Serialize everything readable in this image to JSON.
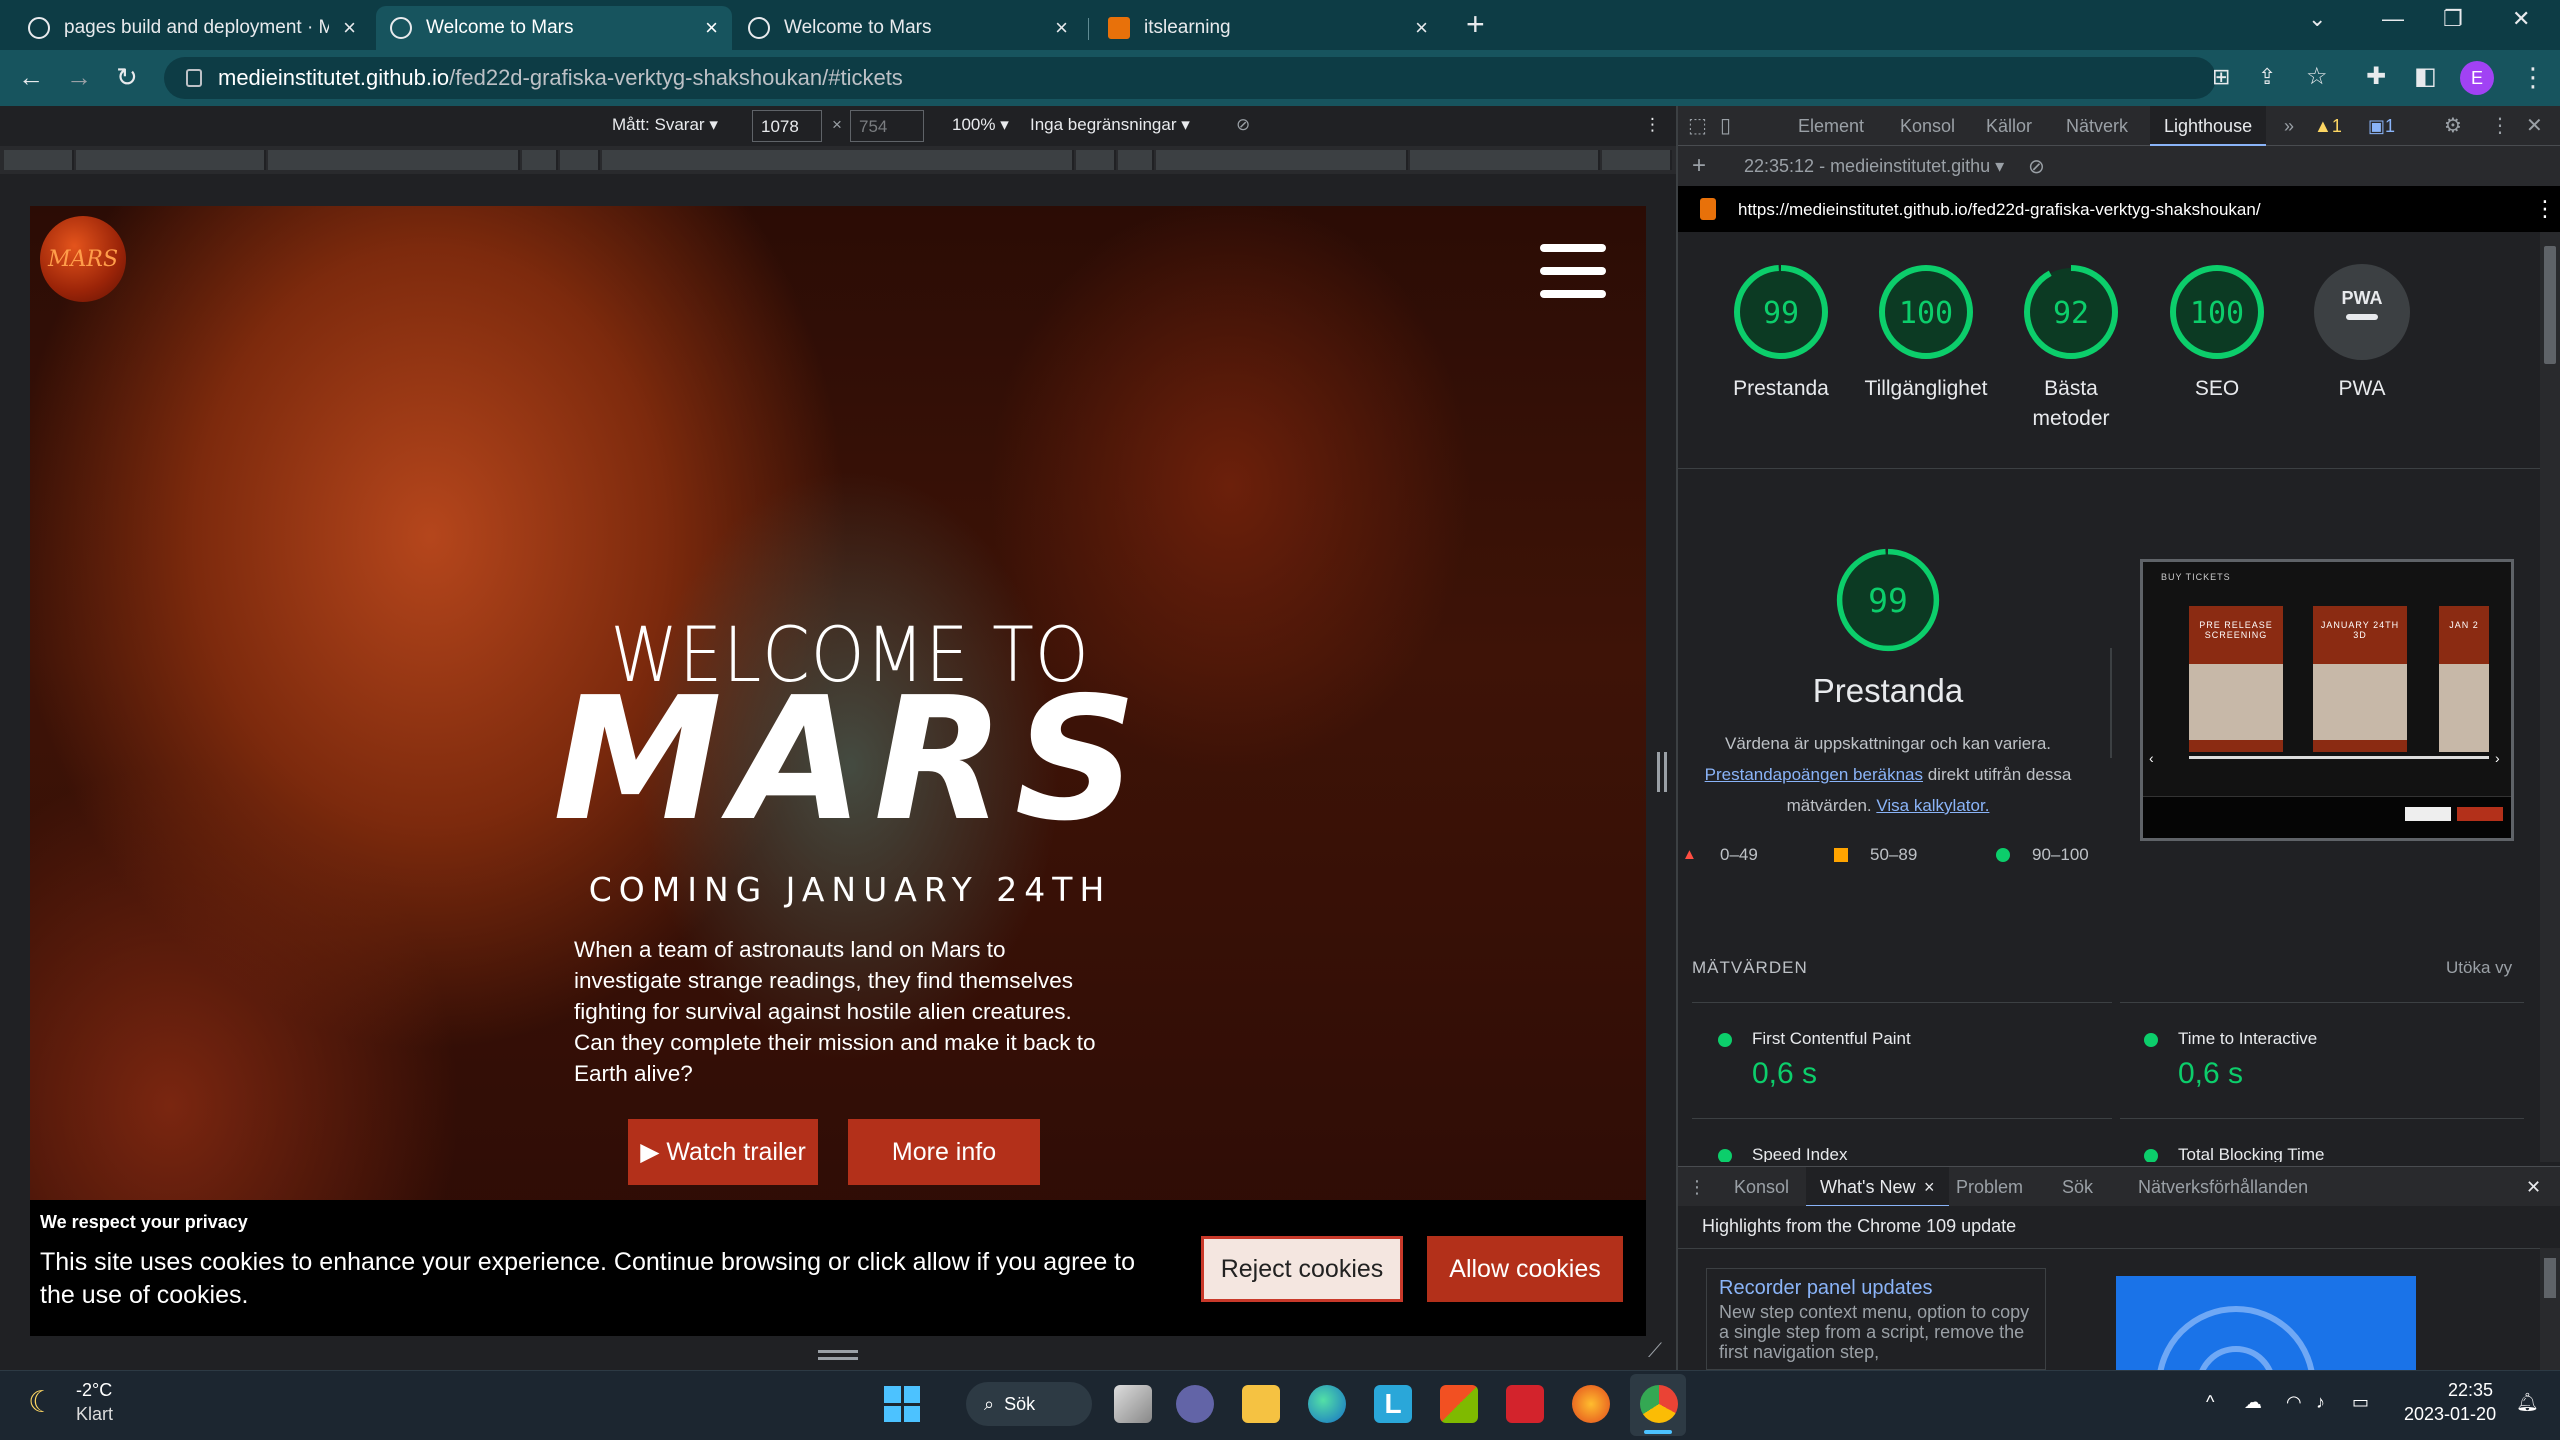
{
  "browser": {
    "tabs": [
      {
        "title": "pages build and deployment · Me",
        "active": false
      },
      {
        "title": "Welcome to Mars",
        "active": true
      },
      {
        "title": "Welcome to Mars",
        "active": false
      },
      {
        "title": "itslearning",
        "active": false
      }
    ],
    "new_tab": "+",
    "url_host": "medieinstitutet.github.io",
    "url_path": "/fed22d-grafiska-verktyg-shakshoukan/#tickets",
    "profile_initial": "E"
  },
  "device_toolbar": {
    "dimensions_label": "Mått: Svarar",
    "width": "1078",
    "height": "754",
    "times": "×",
    "zoom": "100%",
    "throttling": "Inga begränsningar"
  },
  "page": {
    "logo_text": "MARS",
    "hero_line1": "WELCOME TO",
    "hero_line2": "MARS",
    "hero_coming": "COMING JANUARY 24TH",
    "hero_description": "When a team of astronauts land on Mars to investigate strange readings, they find themselves fighting for survival against hostile alien creatures. Can they complete their mission and make it back to Earth alive?",
    "watch_trailer": "▶ Watch trailer",
    "more_info": "More info",
    "cookie_title": "We respect your privacy",
    "cookie_text": "This site uses cookies to enhance your experience. Continue browsing or click allow if you agree to the use of cookies.",
    "reject": "Reject cookies",
    "allow": "Allow cookies"
  },
  "devtools": {
    "tabs": [
      "Element",
      "Konsol",
      "Källor",
      "Nätverk",
      "Lighthouse"
    ],
    "active_tab": "Lighthouse",
    "more": "»",
    "warnings": "1",
    "messages": "1",
    "report_time": "22:35:12 - medieinstitutet.githu",
    "report_url": "https://medieinstitutet.github.io/fed22d-grafiska-verktyg-shakshoukan/",
    "scores": [
      {
        "value": "99",
        "label": "Prestanda",
        "fraction": 0.99
      },
      {
        "value": "100",
        "label": "Tillgänglighet",
        "fraction": 1.0
      },
      {
        "value": "92",
        "label": "Bästa metoder",
        "fraction": 0.92
      },
      {
        "value": "100",
        "label": "SEO",
        "fraction": 1.0
      }
    ],
    "pwa_badge": "PWA",
    "pwa_label": "PWA",
    "perf_big_score": "99",
    "perf_title": "Prestanda",
    "perf_note_1": "Värdena är uppskattningar och kan variera.",
    "perf_link_1": "Prestandapoängen beräknas",
    "perf_note_2": " direkt utifrån dessa mätvärden. ",
    "perf_link_2": "Visa kalkylator.",
    "legend": [
      "0–49",
      "50–89",
      "90–100"
    ],
    "thumb_title": "BUY TICKETS",
    "thumb_cards": [
      "PRE RELEASE SCREENING",
      "JANUARY 24TH 3D",
      "JAN 2"
    ],
    "metrics_heading": "MÄTVÄRDEN",
    "expand_view": "Utöka vy",
    "metrics": [
      {
        "name": "First Contentful Paint",
        "value": "0,6 s"
      },
      {
        "name": "Time to Interactive",
        "value": "0,6 s"
      },
      {
        "name": "Speed Index",
        "value": ""
      },
      {
        "name": "Total Blocking Time",
        "value": ""
      }
    ],
    "drawer_tabs": [
      "Konsol",
      "What's New",
      "Problem",
      "Sök",
      "Nätverksförhållanden"
    ],
    "drawer_active": "What's New",
    "drawer_heading": "Highlights from the Chrome 109 update",
    "drawer_card_title": "Recorder panel updates",
    "drawer_card_text": "New step context menu, option to copy a single step from a script, remove the first navigation step,"
  },
  "taskbar": {
    "weather_temp": "-2°C",
    "weather_text": "Klart",
    "search": "Sök",
    "time": "22:35",
    "date": "2023-01-20"
  },
  "colors": {
    "score_green": "#0cce6b",
    "mars_red": "#b3301a",
    "chrome_frame": "#0d3c45"
  }
}
